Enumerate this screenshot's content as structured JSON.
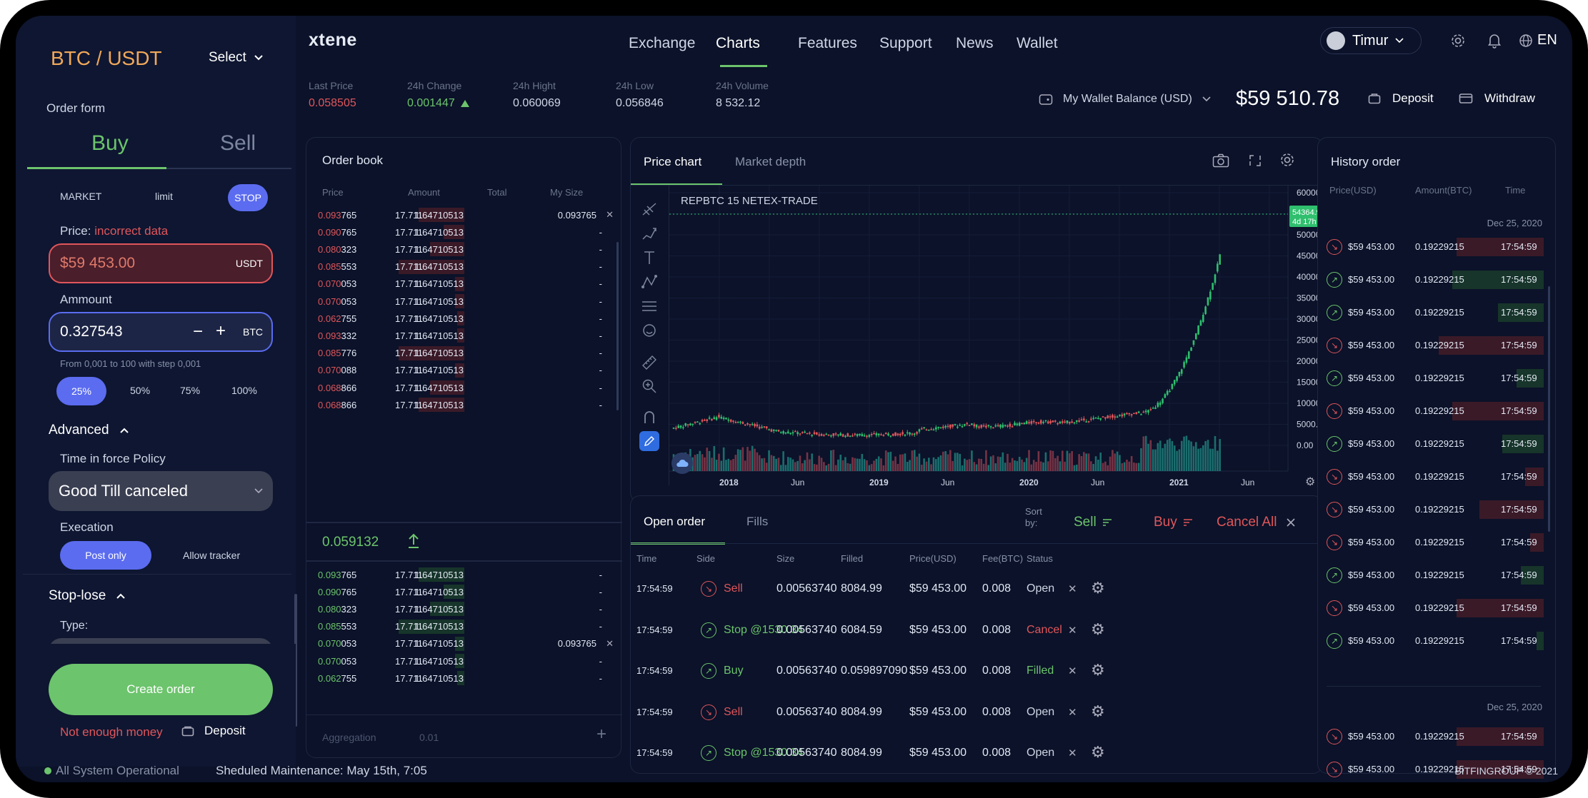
{
  "sidebar": {
    "pair": "BTC / USDT",
    "select_label": "Select",
    "order_form_title": "Order form",
    "tabs": [
      "Buy",
      "Sell"
    ],
    "order_types": [
      "MARKET",
      "limit",
      "STOP"
    ],
    "price_label": "Price:",
    "price_error": "incorrect data",
    "price_value": "$59 453.00",
    "price_unit": "USDT",
    "amount_label": "Ammount",
    "amount_value": "0.327543",
    "amount_unit": "BTC",
    "amount_hint": "From 0,001 to 100 with step 0,001",
    "percents": [
      "25%",
      "50%",
      "75%",
      "100%"
    ],
    "advanced_label": "Advanced",
    "tif_label": "Time in force Policy",
    "tif_value": "Good Till canceled",
    "execution_label": "Execation",
    "execution_options": [
      "Post only",
      "Allow tracker"
    ],
    "stoplose_label": "Stop-lose",
    "type_label": "Type:",
    "create_order": "Create order",
    "not_enough": "Not enough money",
    "deposit": "Deposit"
  },
  "header": {
    "logo": "xtene",
    "nav": [
      "Exchange",
      "Charts",
      "Features",
      "Support",
      "News",
      "Wallet"
    ],
    "active_nav": "Charts",
    "user": "Timur",
    "lang": "EN"
  },
  "stats": [
    {
      "label": "Last Price",
      "value": "0.058505"
    },
    {
      "label": "24h Change",
      "value": "0.001447"
    },
    {
      "label": "24h Hight",
      "value": "0.060069"
    },
    {
      "label": "24h Low",
      "value": "0.056846"
    },
    {
      "label": "24h Volume",
      "value": "8 532.12"
    }
  ],
  "wallet": {
    "label": "My Wallet Balance (USD)",
    "balance": "$59 510.78",
    "deposit": "Deposit",
    "withdraw": "Withdraw"
  },
  "orderbook": {
    "title": "Order book",
    "headers": [
      "Price",
      "Amount",
      "Total",
      "My Size"
    ],
    "asks": [
      {
        "p1": "0.093",
        "p2": "765",
        "amt": "17.711",
        "total": "1.64710513",
        "size": "0.093765",
        "fill": 1.0
      },
      {
        "p1": "0.090",
        "p2": "765",
        "amt": "17.711",
        "total": "1.64710513",
        "size": "-",
        "fill": 0.45
      },
      {
        "p1": "0.080",
        "p2": "323",
        "amt": "17.711",
        "total": "1.64710513",
        "size": "-",
        "fill": 0.75
      },
      {
        "p1": "0.085",
        "p2": "553",
        "amt": "17.711",
        "total": "1.64710513",
        "size": "-",
        "fill": 1.45
      },
      {
        "p1": "0.070",
        "p2": "053",
        "amt": "17.711",
        "total": "1.64710513",
        "size": "-",
        "fill": 0.2
      },
      {
        "p1": "0.070",
        "p2": "053",
        "amt": "17.711",
        "total": "1.64710513",
        "size": "-",
        "fill": 0.2
      },
      {
        "p1": "0.062",
        "p2": "755",
        "amt": "17.711",
        "total": "1.64710513",
        "size": "-",
        "fill": 0.15
      },
      {
        "p1": "0.093",
        "p2": "332",
        "amt": "17.711",
        "total": "1.64710513",
        "size": "-",
        "fill": 0.15
      },
      {
        "p1": "0.085",
        "p2": "776",
        "amt": "17.711",
        "total": "1.64710513",
        "size": "-",
        "fill": 1.45
      },
      {
        "p1": "0.070",
        "p2": "088",
        "amt": "17.711",
        "total": "1.64710513",
        "size": "-",
        "fill": 0.2
      },
      {
        "p1": "0.068",
        "p2": "866",
        "amt": "17.711",
        "total": "1.64710513",
        "size": "-",
        "fill": 0.75
      },
      {
        "p1": "0.068",
        "p2": "866",
        "amt": "17.711",
        "total": "1.64710513",
        "size": "-",
        "fill": 1.0
      }
    ],
    "mid_price": "0.059132",
    "bids": [
      {
        "p1": "0.093",
        "p2": "765",
        "amt": "17.711",
        "total": "1.64710513",
        "size": "-",
        "fill": 1.0
      },
      {
        "p1": "0.090",
        "p2": "765",
        "amt": "17.711",
        "total": "1.64710513",
        "size": "-",
        "fill": 0.45
      },
      {
        "p1": "0.080",
        "p2": "323",
        "amt": "17.711",
        "total": "1.64710513",
        "size": "-",
        "fill": 0.75
      },
      {
        "p1": "0.085",
        "p2": "553",
        "amt": "17.711",
        "total": "1.64710513",
        "size": "-",
        "fill": 1.45
      },
      {
        "p1": "0.070",
        "p2": "053",
        "amt": "17.711",
        "total": "1.64710513",
        "size": "0.093765",
        "fill": 0.2
      },
      {
        "p1": "0.070",
        "p2": "053",
        "amt": "17.711",
        "total": "1.64710513",
        "size": "-",
        "fill": 0.2
      },
      {
        "p1": "0.062",
        "p2": "755",
        "amt": "17.711",
        "total": "1.64710513",
        "size": "-",
        "fill": 0.15
      }
    ],
    "aggregation_label": "Aggregation",
    "aggregation_value": "0.01"
  },
  "chart": {
    "tabs": [
      "Price chart",
      "Market depth"
    ],
    "symbol": "REPBTC 15 NETEX-TRADE",
    "price_tag": "54364.92",
    "price_tag_sub": "4d 17h",
    "y_ticks": [
      "60000.00",
      "55000.00",
      "50000.00",
      "45000.00",
      "40000.00",
      "35000.00",
      "30000.00",
      "25000.00",
      "20000.00",
      "15000.00",
      "10000.00",
      "5000.00",
      "0.00"
    ],
    "x_ticks": [
      "2018",
      "Jun",
      "2019",
      "Jun",
      "2020",
      "Jun",
      "2021",
      "Jun"
    ]
  },
  "orders": {
    "tabs": [
      "Open order",
      "Fills"
    ],
    "sort_label": "Sort by:",
    "sell": "Sell",
    "buy": "Buy",
    "cancel_all": "Cancel All",
    "headers": [
      "Time",
      "Side",
      "Size",
      "Filled",
      "Price(USD)",
      "Fee(BTC)",
      "Status"
    ],
    "rows": [
      {
        "time": "17:54:59",
        "side": "Sell",
        "dir": "down",
        "size": "0.00563740",
        "filled": "8084.99",
        "price": "$59 453.00",
        "fee": "0.008",
        "status": "Open"
      },
      {
        "time": "17:54:59",
        "side": "Stop @1530.34",
        "dir": "up",
        "size": "0.00563740",
        "filled": "6084.59",
        "price": "$59 453.00",
        "fee": "0.008",
        "status": "Cancel"
      },
      {
        "time": "17:54:59",
        "side": "Buy",
        "dir": "up",
        "size": "0.00563740",
        "filled": "0.059897090",
        "price": "$59 453.00",
        "fee": "0.008",
        "status": "Filled"
      },
      {
        "time": "17:54:59",
        "side": "Sell",
        "dir": "down",
        "size": "0.00563740",
        "filled": "8084.99",
        "price": "$59 453.00",
        "fee": "0.008",
        "status": "Open"
      },
      {
        "time": "17:54:59",
        "side": "Stop @1530.34",
        "dir": "up",
        "size": "0.00563740",
        "filled": "8084.99",
        "price": "$59 453.00",
        "fee": "0.008",
        "status": "Open"
      }
    ]
  },
  "history": {
    "title": "History order",
    "headers": [
      "Price(USD)",
      "Amount(BTC)",
      "Time"
    ],
    "date": "Dec 25, 2020",
    "rows": [
      {
        "dir": "down",
        "price": "$59 453.00",
        "amount": "0.19229215",
        "time": "17:54:59",
        "fill": 0.95
      },
      {
        "dir": "up",
        "price": "$59 453.00",
        "amount": "0.19229215",
        "time": "17:54:59",
        "fill": 1.0
      },
      {
        "dir": "up",
        "price": "$59 453.00",
        "amount": "0.19229215",
        "time": "17:54:59",
        "fill": 0.5
      },
      {
        "dir": "down",
        "price": "$59 453.00",
        "amount": "0.19229215",
        "time": "17:54:59",
        "fill": 1.15
      },
      {
        "dir": "up",
        "price": "$59 453.00",
        "amount": "0.19229215",
        "time": "17:54:59",
        "fill": 0.3
      },
      {
        "dir": "down",
        "price": "$59 453.00",
        "amount": "0.19229215",
        "time": "17:54:59",
        "fill": 1.0
      },
      {
        "dir": "up",
        "price": "$59 453.00",
        "amount": "0.19229215",
        "time": "17:54:59",
        "fill": 0.45
      },
      {
        "dir": "down",
        "price": "$59 453.00",
        "amount": "0.19229215",
        "time": "17:54:59",
        "fill": 0.2
      },
      {
        "dir": "down",
        "price": "$59 453.00",
        "amount": "0.19229215",
        "time": "17:54:59",
        "fill": 0.7
      },
      {
        "dir": "down",
        "price": "$59 453.00",
        "amount": "0.19229215",
        "time": "17:54:59",
        "fill": 0.15
      },
      {
        "dir": "up",
        "price": "$59 453.00",
        "amount": "0.19229215",
        "time": "17:54:59",
        "fill": 0.25
      },
      {
        "dir": "down",
        "price": "$59 453.00",
        "amount": "0.19229215",
        "time": "17:54:59",
        "fill": 0.95
      },
      {
        "dir": "up",
        "price": "$59 453.00",
        "amount": "0.19229215",
        "time": "17:54:59",
        "fill": 0.08
      }
    ],
    "date2": "Dec 25, 2020",
    "rows2": [
      {
        "dir": "down",
        "price": "$59 453.00",
        "amount": "0.19229215",
        "time": "17:54:59",
        "fill": 0.95
      },
      {
        "dir": "down",
        "price": "$59 453.00",
        "amount": "0.19229215",
        "time": "17:54:59",
        "fill": 0.95
      }
    ]
  },
  "footer": {
    "status": "All System Operational",
    "maintenance": "Sheduled Maintenance: May 15th, 7:05",
    "copyright": "BITFINGROUP © 2021"
  },
  "colors": {
    "accent": "#5b6cf0",
    "green": "#6cc46c",
    "red": "#e0565b",
    "bg": "#0b1229"
  }
}
